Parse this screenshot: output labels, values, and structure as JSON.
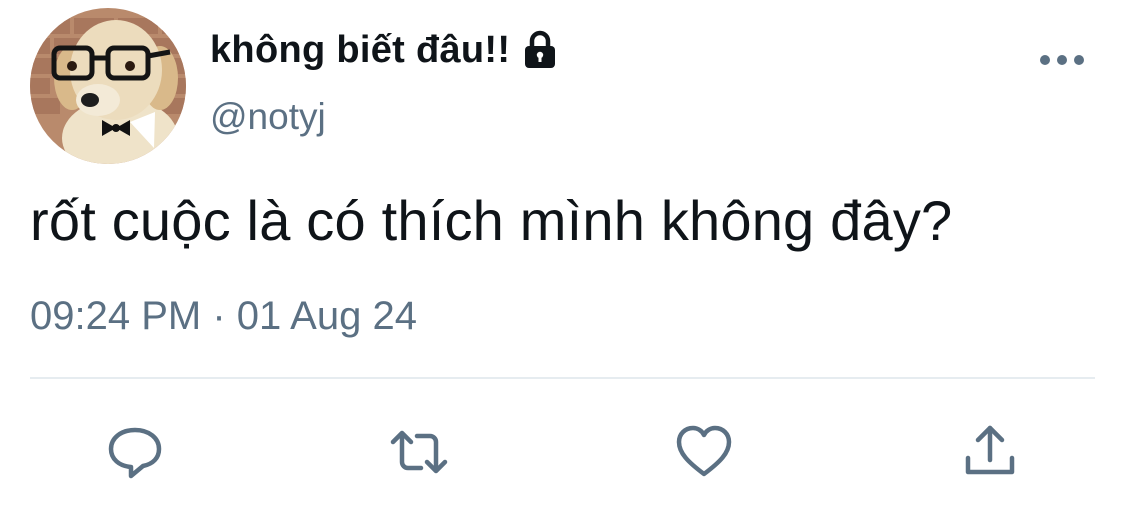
{
  "tweet": {
    "display_name": "không biết đâu!!",
    "handle": "@notyj",
    "text": "rốt cuộc là có thích mình không đây?",
    "timestamp": "09:24 PM · 01 Aug 24",
    "protected": true
  },
  "icons": {
    "avatar": "dog-with-glasses-and-bowtie-avatar",
    "lock": "lock-icon",
    "more": "more-options-icon",
    "reply": "reply-icon",
    "retweet": "retweet-icon",
    "like": "heart-icon",
    "share": "share-icon"
  },
  "colors": {
    "text_primary": "#0f1419",
    "text_secondary": "#5b7083",
    "divider": "#e6ecf0",
    "background": "#ffffff"
  }
}
